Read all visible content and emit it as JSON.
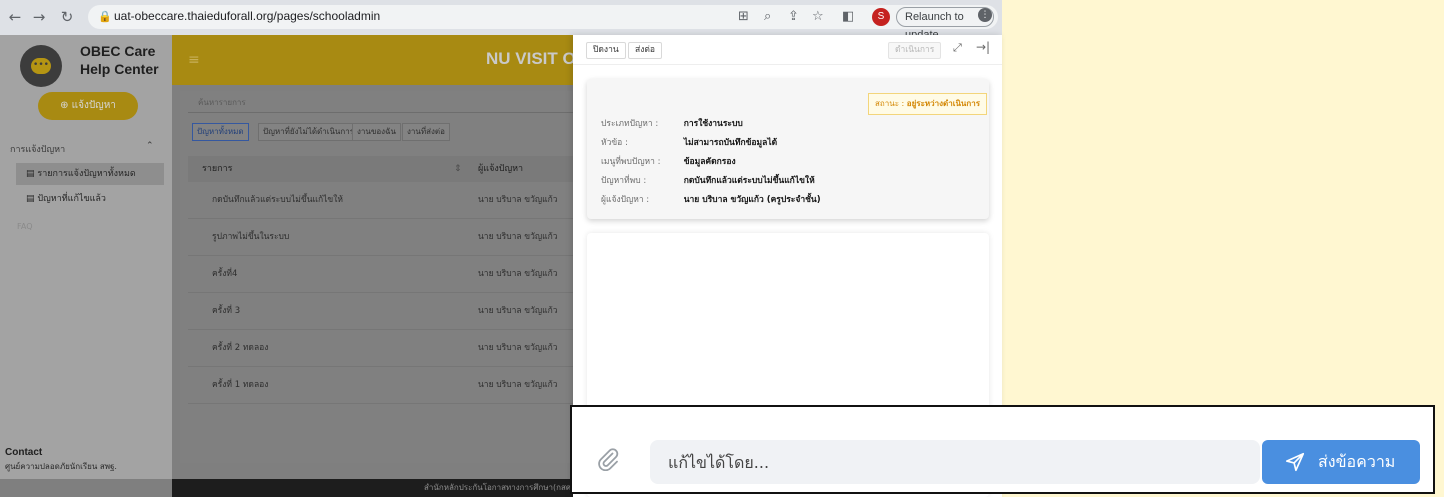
{
  "browser": {
    "url": "uat-obeccare.thaieduforall.org/pages/schooladmin",
    "relaunch_label": "Relaunch to update",
    "profile_initial": "S"
  },
  "sidebar": {
    "brand_line1": "OBEC Care",
    "brand_line2": "Help Center",
    "report_button": "แจ้งปัญหา",
    "menu_heading": "การแจ้งปัญหา",
    "items": [
      {
        "label": "รายการแจ้งปัญหาทั้งหมด"
      },
      {
        "label": "ปัญหาที่แก้ไขแล้ว"
      }
    ],
    "faq": "FAQ",
    "contact_title": "Contact",
    "contact_sub": "ศูนย์ความปลอดภัยนักเรียน สพฐ."
  },
  "topbar": {
    "title": "NU VISIT O"
  },
  "list": {
    "search_placeholder": "ค้นหารายการ",
    "filter_tabs": [
      "ปัญหาทั้งหมด",
      "ปัญหาที่ยังไม่ได้ดำเนินการ",
      "งานของฉัน",
      "งานที่ส่งต่อ"
    ],
    "columns": {
      "title": "รายการ",
      "reporter": "ผู้แจ้งปัญหา"
    },
    "rows": [
      {
        "title": "กดบันทึกแล้วแต่ระบบไม่ขึ้นแก้ไขให้",
        "reporter": "นาย บริบาล ขวัญแก้ว"
      },
      {
        "title": "รูปภาพไม่ขึ้นในระบบ",
        "reporter": "นาย บริบาล ขวัญแก้ว"
      },
      {
        "title": "ครั้งที่4",
        "reporter": "นาย บริบาล ขวัญแก้ว"
      },
      {
        "title": "ครั้งที่ 3",
        "reporter": "นาย บริบาล ขวัญแก้ว"
      },
      {
        "title": "ครั้งที่ 2 ทดลอง",
        "reporter": "นาย บริบาล ขวัญแก้ว"
      },
      {
        "title": "ครั้งที่ 1 ทดลอง",
        "reporter": "นาย บริบาล ขวัญแก้ว"
      }
    ],
    "footer": "สำนักหลักประกันโอกาสทางการศึกษา(กสศ.)"
  },
  "drawer": {
    "close_label": "ปิดงาน",
    "forward_label": "ส่งต่อ",
    "proceed_label": "ดำเนินการ",
    "status_label": "สถานะ :",
    "status_value": "อยู่ระหว่างดำเนินการ",
    "details": [
      {
        "label": "ประเภทปัญหา :",
        "value": "การใช้งานระบบ"
      },
      {
        "label": "หัวข้อ :",
        "value": "ไม่สามารถบันทึกข้อมูลได้"
      },
      {
        "label": "เมนูที่พบปัญหา :",
        "value": "ข้อมูลคัดกรอง"
      },
      {
        "label": "ปัญหาที่พบ :",
        "value": "กดบันทึกแล้วแต่ระบบไม่ขึ้นแก้ไขให้"
      },
      {
        "label": "ผู้แจ้งปัญหา :",
        "value": "นาย บริบาล ขวัญแก้ว (ครูประจำชั้น)"
      }
    ]
  },
  "composer": {
    "placeholder": "แก้ไขได้โดย...",
    "send_label": "ส่งข้อความ"
  }
}
